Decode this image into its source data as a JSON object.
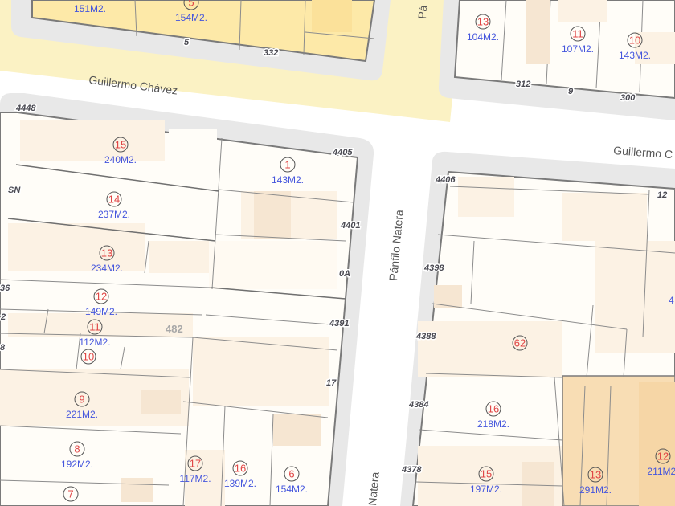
{
  "colors": {
    "background": "#ffffff",
    "highlight_zone": "#fbf2c4",
    "block_fill": "#fffdf8",
    "sidewalk": "#e8e8e8",
    "lot_line": "#8c8c8c",
    "block_edge": "#7a7a7a",
    "building_light": "#fcf2e4",
    "building_mid": "#f6e6d2",
    "building_orange": "#f8ddb4",
    "yellow_lot": "#fde9a8",
    "lot_number": "#e04545",
    "area_text": "#4455dd",
    "door_text": "#4a4a52"
  },
  "streets": [
    {
      "id": "guillermo-chavez-west",
      "text": "Guillermo Chávez"
    },
    {
      "id": "guillermo-chavez-east",
      "text": "Guillermo C"
    },
    {
      "id": "panfilo-natera",
      "text": "Pánfilo Natera"
    },
    {
      "id": "panfilo-natera-south",
      "text": "Natera"
    },
    {
      "id": "panfilo-top",
      "text": "Pá"
    }
  ],
  "door_numbers": [
    "5",
    "332",
    "312",
    "9",
    "300",
    "4448",
    "4405",
    "SN",
    "4401",
    "0A",
    "4391",
    "17",
    "482",
    "36",
    "2",
    "8",
    "4406",
    "12",
    "4398",
    "4388",
    "4384",
    "4378"
  ],
  "lots": [
    {
      "id": "lot-top-151",
      "number": "",
      "area": "151M2."
    },
    {
      "id": "lot-top-5",
      "number": "5",
      "area": "154M2."
    },
    {
      "id": "lot-top-13",
      "number": "13",
      "area": "104M2."
    },
    {
      "id": "lot-top-11",
      "number": "11",
      "area": "107M2."
    },
    {
      "id": "lot-top-10",
      "number": "10",
      "area": "143M2."
    },
    {
      "id": "lot-15",
      "number": "15",
      "area": "240M2."
    },
    {
      "id": "lot-1",
      "number": "1",
      "area": "143M2."
    },
    {
      "id": "lot-14",
      "number": "14",
      "area": "237M2."
    },
    {
      "id": "lot-13",
      "number": "13",
      "area": "234M2."
    },
    {
      "id": "lot-12",
      "number": "12",
      "area": "149M2."
    },
    {
      "id": "lot-11",
      "number": "11",
      "area": "112M2."
    },
    {
      "id": "lot-10",
      "number": "10",
      "area": ""
    },
    {
      "id": "lot-9",
      "number": "9",
      "area": "221M2."
    },
    {
      "id": "lot-8",
      "number": "8",
      "area": "192M2."
    },
    {
      "id": "lot-7",
      "number": "7",
      "area": ""
    },
    {
      "id": "lot-17",
      "number": "17",
      "area": "117M2."
    },
    {
      "id": "lot-16",
      "number": "16",
      "area": "139M2."
    },
    {
      "id": "lot-6",
      "number": "6",
      "area": "154M2."
    },
    {
      "id": "lot-62",
      "number": "62",
      "area": ""
    },
    {
      "id": "lot-16-east",
      "number": "16",
      "area": "218M2."
    },
    {
      "id": "lot-15-east",
      "number": "15",
      "area": "197M2."
    },
    {
      "id": "lot-13-east",
      "number": "13",
      "area": "291M2."
    },
    {
      "id": "lot-12-east",
      "number": "12",
      "area": "211M2."
    }
  ],
  "edge_label": "4"
}
